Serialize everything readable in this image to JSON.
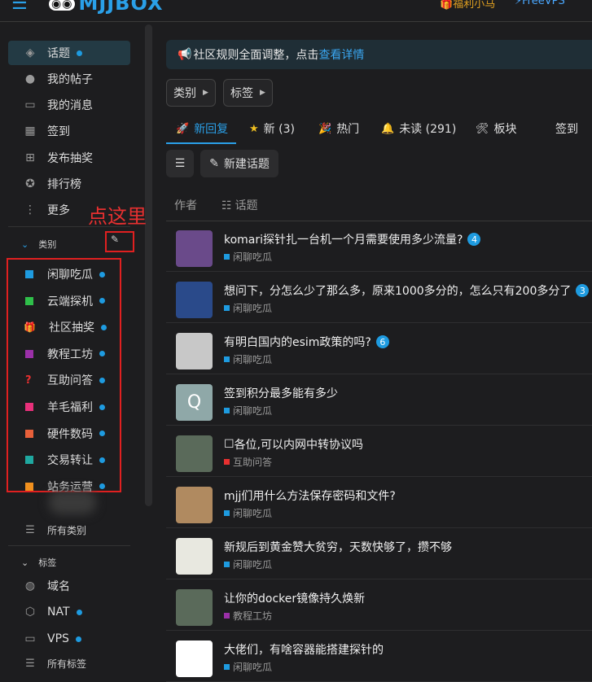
{
  "header": {
    "logo": "MJJBOX",
    "links": [
      "福利小马",
      "FreeVPS"
    ]
  },
  "colors": {
    "accent": "#2aa0e8",
    "annotation_red": "#e02020"
  },
  "sidebar": {
    "items": [
      {
        "label": "话题",
        "icon": "layers-icon",
        "dot": true,
        "active": true
      },
      {
        "label": "我的帖子",
        "icon": "user-icon"
      },
      {
        "label": "我的消息",
        "icon": "inbox-icon"
      },
      {
        "label": "签到",
        "icon": "calendar-icon"
      },
      {
        "label": "发布抽奖",
        "icon": "gift-icon"
      },
      {
        "label": "排行榜",
        "icon": "award-icon"
      },
      {
        "label": "更多",
        "icon": "more-vertical-icon"
      }
    ],
    "annotation": "点这里",
    "categories_header": "类别",
    "categories": [
      {
        "label": "闲聊吃瓜",
        "color": "#1e9be0"
      },
      {
        "label": "云端探机",
        "color": "#2fbf4a"
      },
      {
        "label": "社区抽奖",
        "color": "#e8a020",
        "icon": "gift-icon"
      },
      {
        "label": "教程工坊",
        "color": "#9b30a8"
      },
      {
        "label": "互助问答",
        "color": "#e83030",
        "icon": "question-icon"
      },
      {
        "label": "羊毛福利",
        "color": "#e8307a"
      },
      {
        "label": "硬件数码",
        "color": "#e8603a"
      },
      {
        "label": "交易转让",
        "color": "#1fa8a0"
      },
      {
        "label": "站务运营",
        "color": "#f0901e"
      }
    ],
    "all_categories": "所有类别",
    "tags_header": "标签",
    "tags": [
      {
        "label": "域名",
        "icon": "globe-icon",
        "dot": false
      },
      {
        "label": "NAT",
        "icon": "box-icon",
        "dot": true
      },
      {
        "label": "VPS",
        "icon": "monitor-icon",
        "dot": true
      }
    ],
    "all_tags": "所有标签"
  },
  "main": {
    "banner": {
      "text": "社区规则全面调整，点击",
      "link": "查看详情"
    },
    "filters": [
      "类别",
      "标签"
    ],
    "tabs": [
      {
        "label": "新回复",
        "icon": "rocket-icon",
        "active": true
      },
      {
        "label": "新 (3)",
        "icon": "star-icon"
      },
      {
        "label": "热门",
        "icon": "party-icon"
      },
      {
        "label": "未读 (291)",
        "icon": "bell-icon"
      },
      {
        "label": "板块",
        "icon": "tools-icon"
      },
      {
        "label": "签到",
        "icon": ""
      }
    ],
    "new_topic": "新建话题",
    "columns": {
      "author": "作者",
      "topic": "话题"
    },
    "topics": [
      {
        "title": "komari探针扎一台机一个月需要使用多少流量?",
        "badge": "4",
        "category": "闲聊吃瓜",
        "cat_color": "#1e9be0",
        "avatar_bg": "#6a4a8a"
      },
      {
        "title": "想问下，分怎么少了那么多，原来1000多分的，怎么只有200多分了",
        "badge": "3",
        "category": "闲聊吃瓜",
        "cat_color": "#1e9be0",
        "avatar_bg": "#2a4a8a"
      },
      {
        "title": "有明白国内的esim政策的吗?",
        "badge": "6",
        "category": "闲聊吃瓜",
        "cat_color": "#1e9be0",
        "avatar_bg": "#c8c8c8"
      },
      {
        "title": "签到积分最多能有多少",
        "badge": "",
        "category": "闲聊吃瓜",
        "cat_color": "#1e9be0",
        "avatar_bg": "#8fa8a8",
        "avatar_letter": "Q"
      },
      {
        "title": "各位,可以内网中转协议吗",
        "badge": "",
        "category": "互助问答",
        "cat_color": "#e83030",
        "avatar_bg": "#5a6a5a",
        "prefix": "☐"
      },
      {
        "title": "mjj们用什么方法保存密码和文件?",
        "badge": "",
        "category": "闲聊吃瓜",
        "cat_color": "#1e9be0",
        "avatar_bg": "#b08a60"
      },
      {
        "title": "新规后到黄金赞大贫穷，天数快够了，攒不够",
        "badge": "",
        "category": "闲聊吃瓜",
        "cat_color": "#1e9be0",
        "avatar_bg": "#e8e8e0"
      },
      {
        "title": "让你的docker镜像持久焕新",
        "badge": "",
        "category": "教程工坊",
        "cat_color": "#9b30a8",
        "avatar_bg": "#5a6a5a"
      },
      {
        "title": "大佬们，有啥容器能搭建探针的",
        "badge": "",
        "category": "闲聊吃瓜",
        "cat_color": "#1e9be0",
        "avatar_bg": "#ffffff"
      }
    ]
  }
}
